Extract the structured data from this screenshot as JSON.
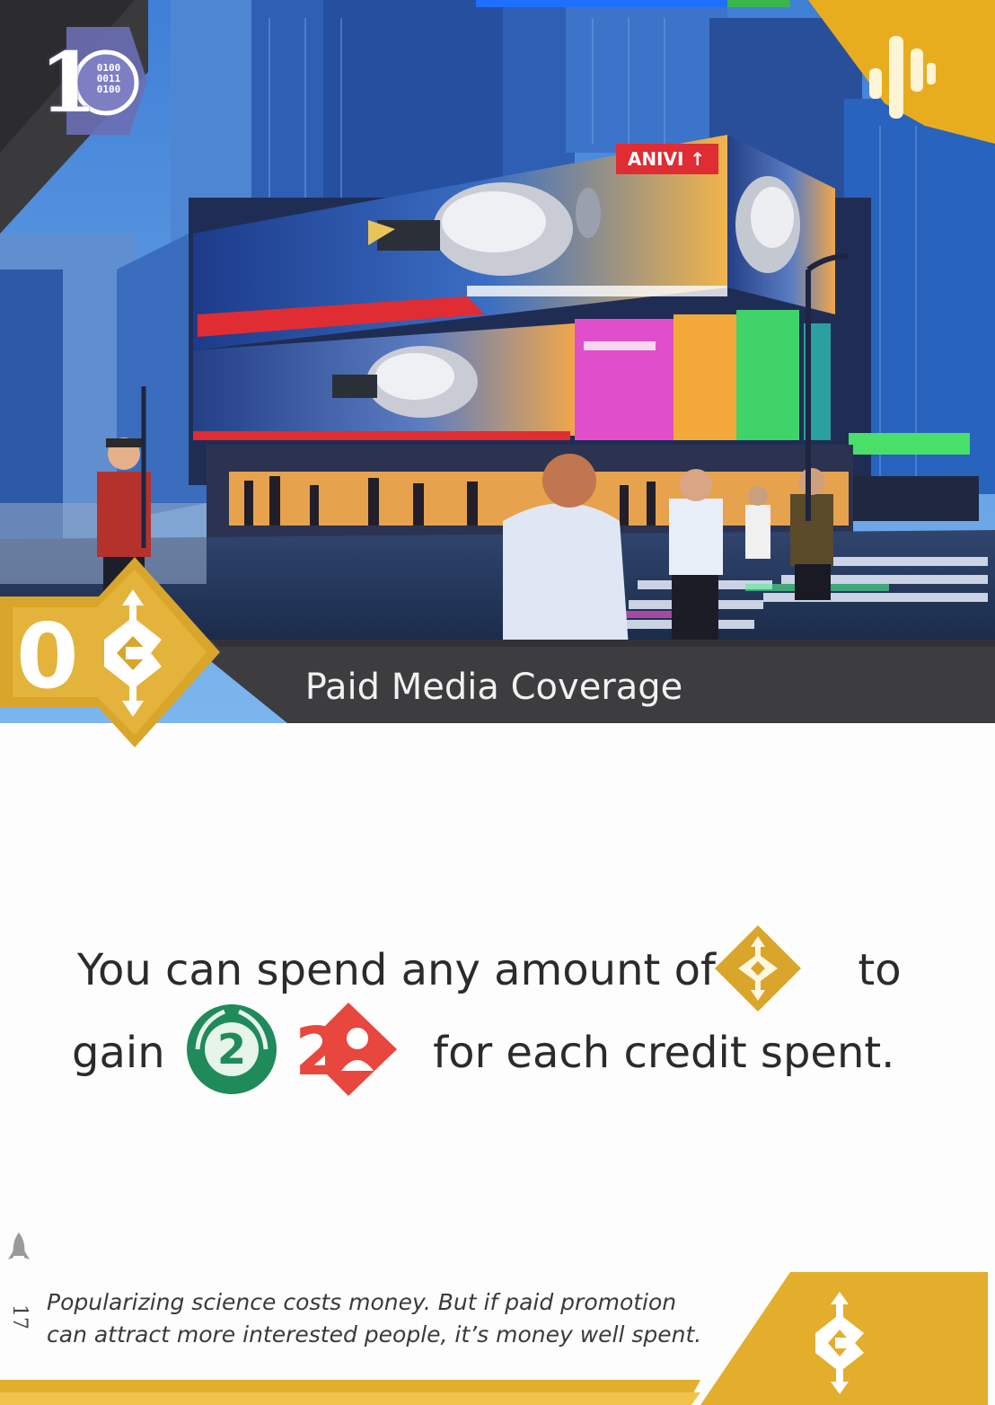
{
  "card": {
    "title": "Paid Media Coverage",
    "cost": "0",
    "corner_value": "1",
    "corner_bits": [
      "0100",
      "0011",
      "0100"
    ],
    "effect_line1": {
      "before": "You can spend any amount of",
      "after": "to"
    },
    "effect_line2": {
      "before": "gain",
      "green_value": "2",
      "red_value": "2",
      "after": "for each credit spent."
    },
    "flavor_line1": "Popularizing science costs money. But if paid promotion",
    "flavor_line2": "can attract more interested people, it’s money well spent.",
    "card_number": "17",
    "icons": {
      "corner": "binary-data-icon",
      "top_right": "signal-bars-icon",
      "cost": "credit-icon",
      "effect_credit": "credit-icon",
      "effect_green": "publicity-laurel-icon",
      "effect_red": "fans-icon",
      "bottom_right": "credit-icon",
      "rocket": "rocket-icon"
    },
    "colors": {
      "gold": "#d9a52a",
      "title_band": "#3d3d3f",
      "green": "#1f8a5a",
      "red": "#e8473e",
      "sky": "#5b9be0"
    }
  }
}
